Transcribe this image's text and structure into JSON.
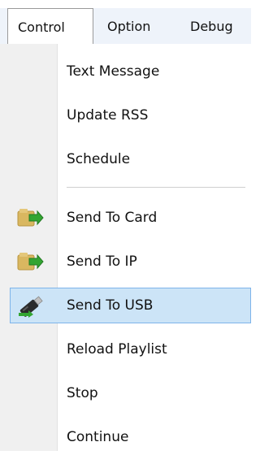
{
  "menubar": {
    "items": [
      {
        "label": "Control"
      },
      {
        "label": "Option"
      },
      {
        "label": "Debug"
      }
    ]
  },
  "menu": {
    "items": [
      {
        "label": "Text Message",
        "icon": null
      },
      {
        "label": "Update RSS",
        "icon": null
      },
      {
        "label": "Schedule",
        "icon": null
      },
      {
        "label": "Send To Card",
        "icon": "card-send-icon"
      },
      {
        "label": "Send To IP",
        "icon": "ip-send-icon"
      },
      {
        "label": "Send To USB",
        "icon": "usb-drive-icon",
        "highlighted": true
      },
      {
        "label": "Reload Playlist",
        "icon": null
      },
      {
        "label": "Stop",
        "icon": null
      },
      {
        "label": "Continue",
        "icon": null
      }
    ]
  },
  "colors": {
    "highlight_fill": "#cce4f7",
    "highlight_border": "#7eb4ea",
    "icon_gutter": "#f0f0f0",
    "arrow_green": "#33a532",
    "folder_tan": "#d9b760"
  }
}
